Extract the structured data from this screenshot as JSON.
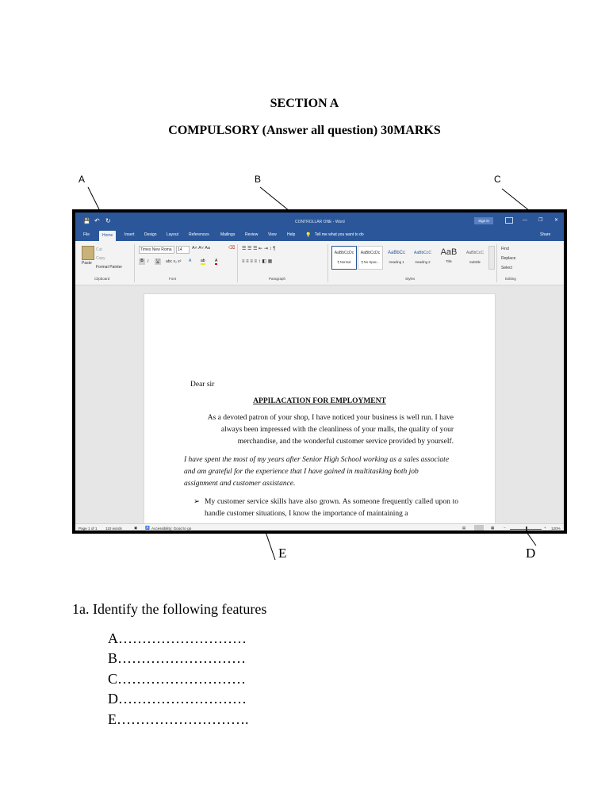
{
  "heading": {
    "title": "SECTION A",
    "subtitle": "COMPULSORY (Answer all question) 30MARKS"
  },
  "callouts": [
    "A",
    "B",
    "C",
    "D",
    "E"
  ],
  "word_window": {
    "qat": [
      "💾",
      "↶",
      "↻"
    ],
    "doc_title": "CONTROLLAR ONE - Word",
    "sign_in": "Sign in",
    "window_controls": [
      "—",
      "❐",
      "✕"
    ],
    "tabs": [
      "File",
      "Home",
      "Insert",
      "Design",
      "Layout",
      "References",
      "Mailings",
      "Review",
      "View",
      "Help"
    ],
    "tell_me": "Tell me what you want to do",
    "share": "Share",
    "clipboard": {
      "paste": "Paste",
      "cut": "Cut",
      "copy": "Copy",
      "format_painter": "Format Painter",
      "label": "Clipboard"
    },
    "font": {
      "name": "Times New Roma",
      "size": "14",
      "label": "Font"
    },
    "paragraph_label": "Paragraph",
    "styles": {
      "items": [
        {
          "preview": "AaBbCcDc",
          "name": "¶ Normal"
        },
        {
          "preview": "AaBbCcDc",
          "name": "¶ No Spac..."
        },
        {
          "preview": "AaBbCc",
          "name": "Heading 1"
        },
        {
          "preview": "AaBbCcC",
          "name": "Heading 2"
        },
        {
          "preview": "AaB",
          "name": "Title"
        },
        {
          "preview": "AaBbCcC",
          "name": "Subtitle"
        }
      ],
      "label": "Styles"
    },
    "editing": {
      "find": "Find",
      "replace": "Replace",
      "select": "Select",
      "label": "Editing"
    },
    "status": {
      "page": "Page 1 of 1",
      "words": "110 words",
      "accessibility": "Accessibility: Good to go",
      "zoom": "120%"
    },
    "letter": {
      "salutation": "Dear sir",
      "title": "APPILACATION FOR EMPLOYMENT",
      "para1": "As a devoted patron of your shop, I have noticed your business is well run. I have always been impressed with the cleanliness of your malls, the quality of your merchandise, and the wonderful customer service provided by yourself.",
      "para2": "I have spent the most of my years after Senior High School working as a sales associate and am grateful for the experience that I have gained in multitasking both job assignment and customer assistance.",
      "bullet": "My customer service skills have also grown. As someone frequently called upon to handle customer situations, I know the importance of maintaining a"
    }
  },
  "question": {
    "text": "1a. Identify the following features",
    "answers": [
      "A………………………",
      "B………………………",
      "C………………………",
      "D………………………",
      "E………………………."
    ]
  }
}
